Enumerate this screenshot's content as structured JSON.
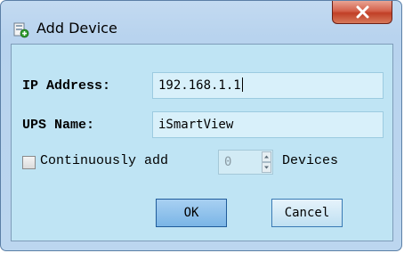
{
  "window": {
    "title": "Add Device",
    "close_glyph": "X"
  },
  "form": {
    "ip_label": "IP Address:",
    "ip_value": "192.168.1.1",
    "ups_label": "UPS Name:",
    "ups_value": "iSmartView",
    "continuously_label": "Continuously add",
    "continuously_checked": false,
    "count_value": "0",
    "devices_label": "Devices"
  },
  "buttons": {
    "ok": "OK",
    "cancel": "Cancel"
  },
  "icons": {
    "app": "add-device-icon",
    "close": "close-icon",
    "spin_up": "spin-up-icon",
    "spin_down": "spin-down-icon"
  }
}
